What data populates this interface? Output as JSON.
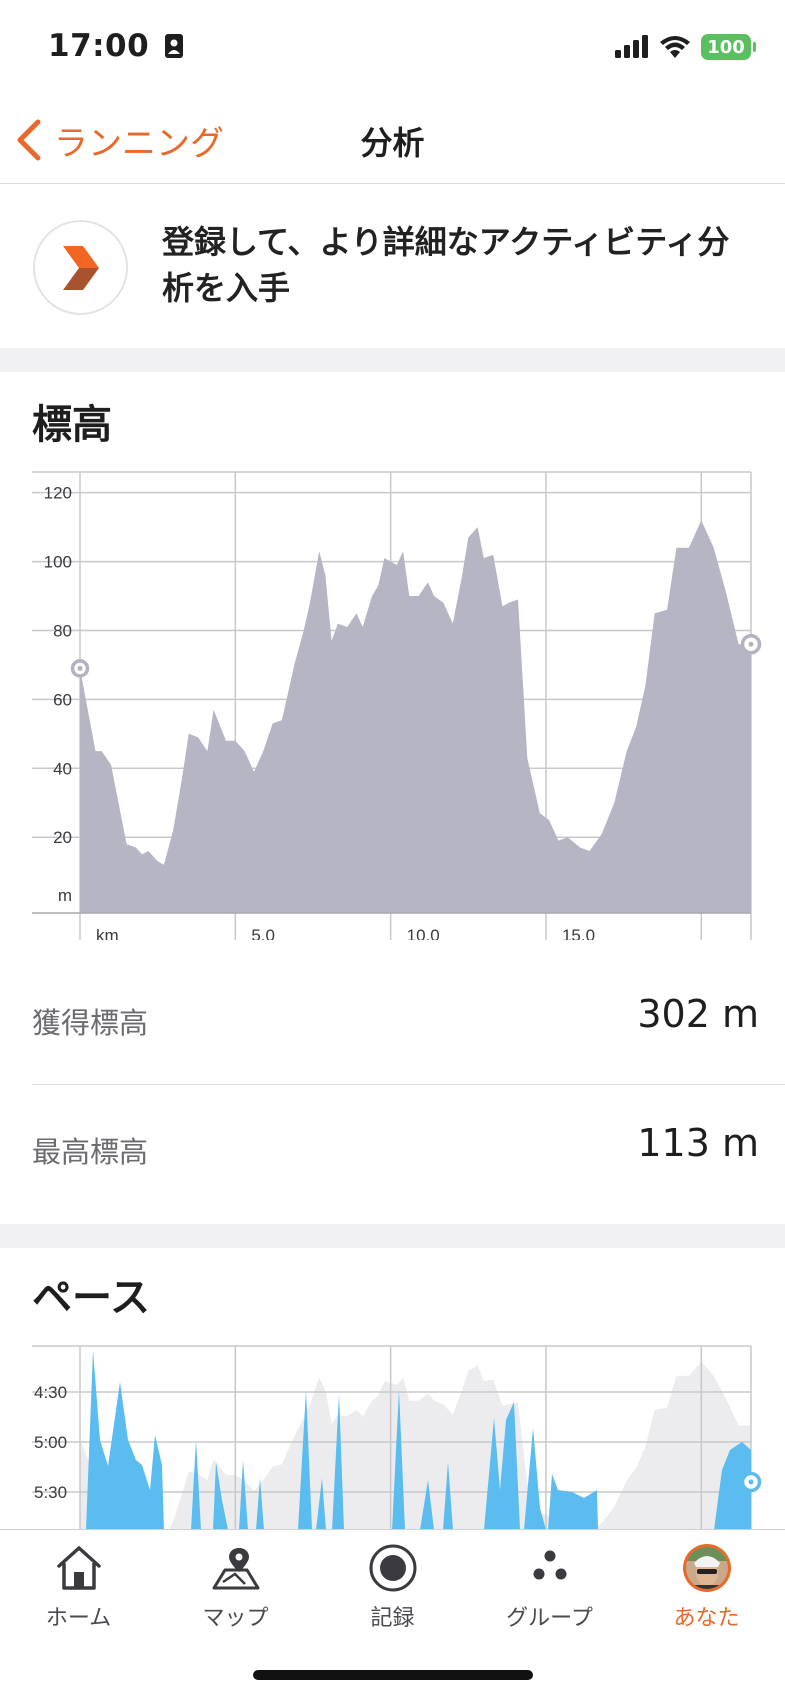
{
  "status_bar": {
    "time": "17:00",
    "battery": "100"
  },
  "nav": {
    "back_label": "ランニング",
    "title": "分析"
  },
  "promo": {
    "text": "登録して、より詳細なアクティビティ分析を入手"
  },
  "elevation": {
    "title": "標高",
    "gain_label": "獲得標高",
    "gain_value": "302 m",
    "max_label": "最高標高",
    "max_value": "113 m"
  },
  "pace": {
    "title": "ペース"
  },
  "tabs": [
    {
      "label": "ホーム",
      "icon": "home-icon"
    },
    {
      "label": "マップ",
      "icon": "map-icon"
    },
    {
      "label": "記録",
      "icon": "record-icon"
    },
    {
      "label": "グループ",
      "icon": "groups-icon"
    },
    {
      "label": "あなた",
      "icon": "avatar-icon",
      "active": true
    }
  ],
  "colors": {
    "accent": "#e86a2a",
    "elevation_fill": "#b6b5c3",
    "pace_fill": "#5bbcef",
    "pace_shadow": "#ececee"
  },
  "chart_data": [
    {
      "type": "area",
      "title": "標高",
      "xlabel": "km",
      "ylabel": "m",
      "xlim": [
        0,
        21.6
      ],
      "ylim": [
        -2,
        126
      ],
      "x_ticks": [
        "km",
        "5.0",
        "10.0",
        "15.0"
      ],
      "y_ticks": [
        "120",
        "100",
        "80",
        "60",
        "40",
        "20",
        "m"
      ],
      "grid": true,
      "series": [
        {
          "x": [
            0.0,
            0.5,
            0.7,
            1.0,
            1.5,
            1.8,
            2.0,
            2.2,
            2.5,
            2.7,
            3.0,
            3.3,
            3.5,
            3.8,
            4.1,
            4.3,
            4.7,
            5.0,
            5.3,
            5.6,
            5.9,
            6.2,
            6.5,
            6.9,
            7.2,
            7.4,
            7.7,
            7.9,
            8.1,
            8.3,
            8.6,
            8.9,
            9.1,
            9.4,
            9.6,
            9.8,
            10.2,
            10.4,
            10.6,
            10.9,
            11.2,
            11.4,
            11.7,
            12.0,
            12.3,
            12.5,
            12.8,
            13.0,
            13.3,
            13.6,
            13.8,
            14.1,
            14.4,
            14.8,
            15.1,
            15.4,
            15.7,
            16.1,
            16.4,
            16.8,
            17.2,
            17.6,
            17.9,
            18.2,
            18.5,
            18.9,
            19.2,
            19.6,
            20.0,
            20.4,
            20.8,
            21.2,
            21.6
          ],
          "y": [
            69,
            45,
            45,
            41,
            18,
            17,
            15,
            16,
            13,
            12,
            22,
            38,
            50,
            49,
            45,
            57,
            48,
            48,
            45,
            39,
            45,
            53,
            54,
            70,
            80,
            88,
            103,
            96,
            77,
            82,
            81,
            85,
            81,
            90,
            93,
            101,
            99,
            103,
            90,
            90,
            94,
            90,
            88,
            82,
            96,
            107,
            110,
            101,
            102,
            87,
            88,
            89,
            43,
            27,
            25,
            19,
            20,
            17,
            16,
            21,
            30,
            45,
            52,
            64,
            85,
            86,
            104,
            104,
            112,
            104,
            91,
            76,
            76
          ]
        }
      ]
    },
    {
      "type": "area",
      "title": "ペース",
      "y_ticks": [
        "4:30",
        "5:00",
        "5:30"
      ],
      "grid": true
    }
  ]
}
